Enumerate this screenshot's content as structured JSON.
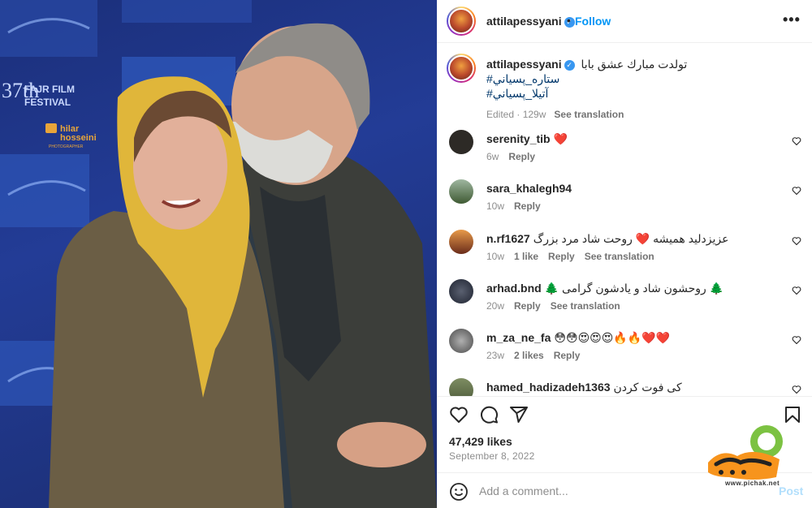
{
  "post": {
    "username": "attilapessyani",
    "verified_mark": "✓",
    "dot": "•",
    "follow_label": "Follow",
    "more_label": "•••",
    "caption": {
      "text": "تولدت مبارك عشق بابا",
      "hashtags": [
        "#ستاره_پسياني",
        "#آتيلا_پسياني"
      ],
      "meta_edited": "Edited · 129w",
      "see_translation": "See translation"
    },
    "comments": [
      {
        "username": "serenity_tib",
        "text": "❤️",
        "age": "6w",
        "likes": "",
        "reply": "Reply",
        "translate": "",
        "avatar_color": "#2d2a26"
      },
      {
        "username": "sara_khalegh94",
        "text": "",
        "age": "10w",
        "likes": "",
        "reply": "Reply",
        "translate": "",
        "avatar_color": "#3f5a33"
      },
      {
        "username": "n.rf1627",
        "text": "عزیزدلید همیشه ❤️ روحت شاد مرد بزرگ",
        "age": "10w",
        "likes": "1 like",
        "reply": "Reply",
        "translate": "See translation",
        "avatar_color": "#c0662a"
      },
      {
        "username": "arhad.bnd",
        "text": "🌲 روحشون شاد و یادشون گرامی 🌲",
        "age": "20w",
        "likes": "",
        "reply": "Reply",
        "translate": "See translation",
        "avatar_color": "#1e2330"
      },
      {
        "username": "m_za_ne_fa",
        "text": "😳😳😍😍😍🔥🔥❤️❤️",
        "age": "23w",
        "likes": "2 likes",
        "reply": "Reply",
        "translate": "",
        "avatar_color": "#6d6d6d"
      },
      {
        "username": "hamed_hadizadeh1363",
        "text": "کی فوت کردن",
        "age": "",
        "likes": "",
        "reply": "",
        "translate": "",
        "avatar_color": "#4d5b3b"
      }
    ],
    "likes": "47,429 likes",
    "date": "September 8, 2022",
    "comment_placeholder": "Add a comment...",
    "post_label": "Post"
  },
  "photo": {
    "backdrop_text_1": "37th",
    "backdrop_text_2": "FAJR FILM",
    "backdrop_text_3": "FESTIVAL",
    "photographer_1": "hilar",
    "photographer_2": "hosseini",
    "photographer_3": "PHOTOGRAPHER"
  },
  "watermark": {
    "site": "www.pichak.net"
  },
  "colors": {
    "accent": "#0095f6",
    "backdrop_blue": "#233c96",
    "scarf_yellow": "#e0b63a",
    "heart_red": "#ed4956"
  },
  "icons": [
    "heart-icon",
    "comment-icon",
    "share-icon",
    "bookmark-icon",
    "emoji-icon",
    "more-icon",
    "verified-icon"
  ]
}
